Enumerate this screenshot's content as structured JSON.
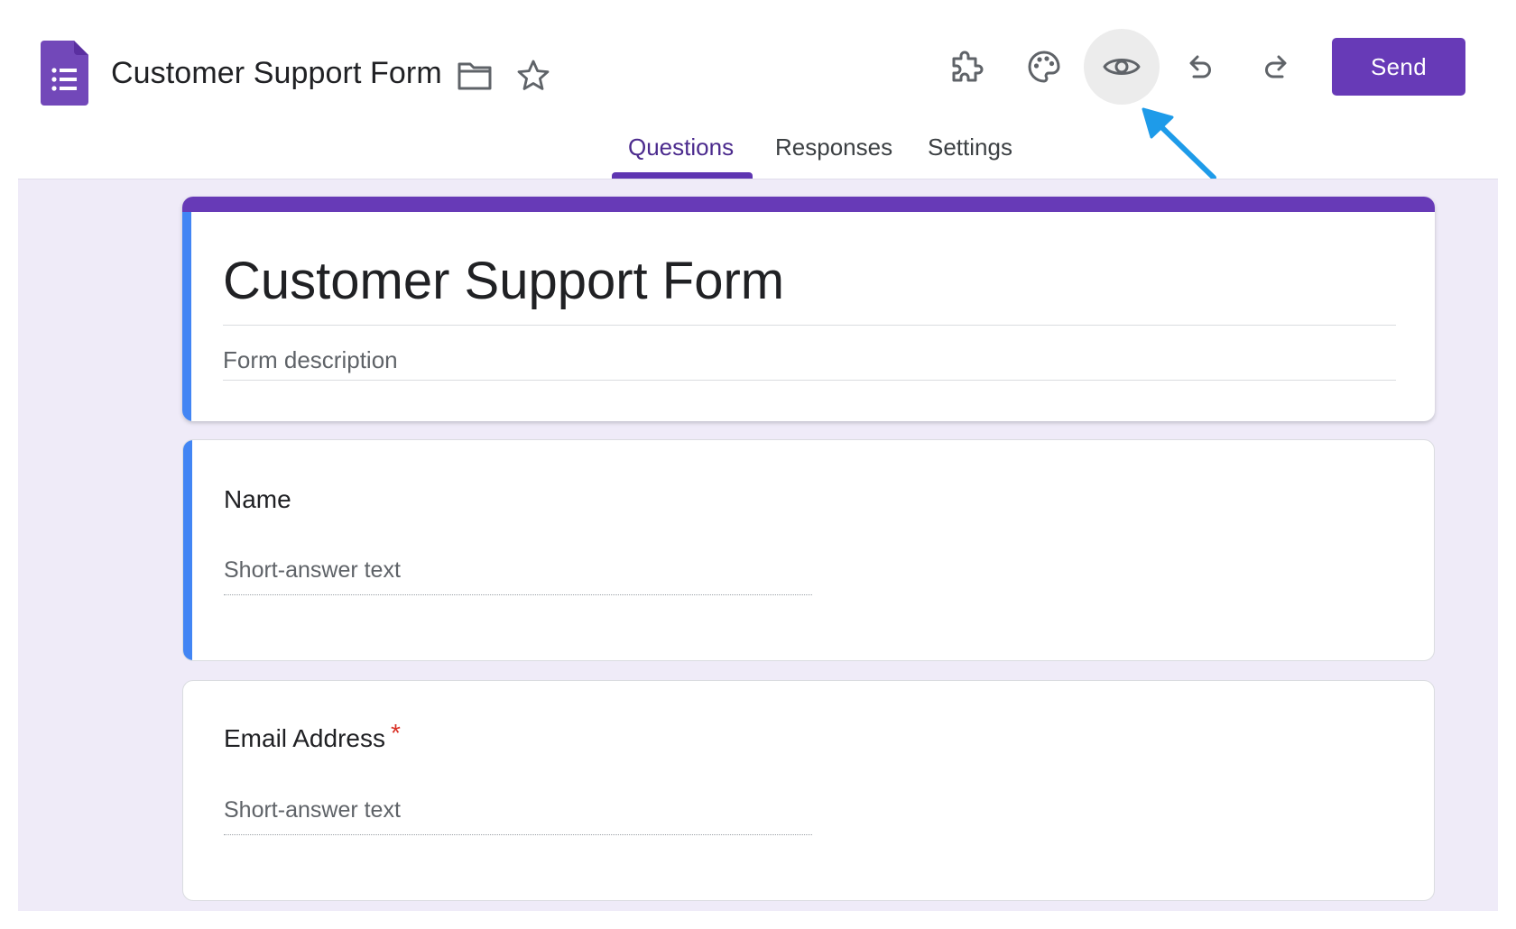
{
  "header": {
    "document_title": "Customer Support Form",
    "title_icons": [
      "folder-icon",
      "star-icon"
    ],
    "toolbar_icons": [
      "addon-icon",
      "palette-icon",
      "eye-icon",
      "undo-icon",
      "redo-icon"
    ],
    "send_label": "Send"
  },
  "tabs": [
    {
      "label": "Questions",
      "active": true
    },
    {
      "label": "Responses",
      "active": false
    },
    {
      "label": "Settings",
      "active": false
    }
  ],
  "form": {
    "title": "Customer Support Form",
    "description_placeholder": "Form description",
    "questions": [
      {
        "label": "Name",
        "required": false,
        "answer_placeholder": "Short-answer text"
      },
      {
        "label": "Email Address",
        "required": true,
        "required_mark": "*",
        "answer_placeholder": "Short-answer text"
      }
    ]
  },
  "colors": {
    "brand": "#673ab7",
    "accent_blue": "#4285f4",
    "background": "#efebf8",
    "annotation_arrow": "#1e9be9",
    "required": "#d93025"
  }
}
